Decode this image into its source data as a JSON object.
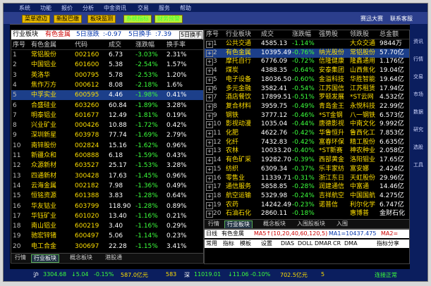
{
  "menubar": {
    "items": [
      "系统",
      "功能",
      "报价",
      "分析",
      "中金资讯",
      "交易",
      "服务",
      "帮助"
    ]
  },
  "toolbar": {
    "btns": [
      "菜单遮边",
      "新股巴缴",
      "板块监测",
      "系统指标",
      "财务预警"
    ],
    "right1": "赛迅大赛",
    "right2": "联系客服"
  },
  "left": {
    "title": {
      "a": "行业板块",
      "b": "有色金属",
      "c": "5日涨跌",
      "d": ":-0.97",
      "e": "5日换手",
      "f": ":7.39",
      "g": "5日换手"
    },
    "headers": [
      "序号",
      "有色金属",
      "代码",
      "成交",
      "涨跌幅",
      "换手率"
    ],
    "rows": [
      [
        "1",
        "常铝股份",
        "002160",
        "6.73",
        "-3.03%",
        "2.31%"
      ],
      [
        "2",
        "中国铝业",
        "601600",
        "5.38",
        "-2.54%",
        "1.57%"
      ],
      [
        "3",
        "英洛华",
        "000795",
        "5.78",
        "-2.53%",
        "1.20%"
      ],
      [
        "4",
        "焦作万方",
        "000612",
        "8.08",
        "-2.18%",
        "1.6%"
      ],
      [
        "5",
        "中孚实业",
        "600595",
        "4.46",
        "-1.98%",
        "0.41%"
      ],
      [
        "6",
        "合盛硅业",
        "603260",
        "60.84",
        "-1.89%",
        "3.28%"
      ],
      [
        "7",
        "明泰铝业",
        "601677",
        "12.49",
        "-1.81%",
        "0.19%"
      ],
      [
        "8",
        "兴业矿业",
        "000426",
        "10.88",
        "-1.72%",
        "0.42%"
      ],
      [
        "9",
        "深圳新星",
        "603978",
        "77.74",
        "-1.69%",
        "2.79%"
      ],
      [
        "10",
        "南锌股份",
        "002824",
        "15.16",
        "-1.62%",
        "0.96%"
      ],
      [
        "11",
        "新疆众和",
        "600888",
        "6.18",
        "-1.59%",
        "0.43%"
      ],
      [
        "12",
        "众源新材",
        "603527",
        "25.17",
        "-1.53%",
        "3.28%"
      ],
      [
        "13",
        "四通新材",
        "300428",
        "17.63",
        "-1.45%",
        "0.96%"
      ],
      [
        "14",
        "云海金属",
        "002182",
        "7.98",
        "-1.36%",
        "0.49%"
      ],
      [
        "15",
        "恒铭资源",
        "601388",
        "3.83",
        "-1.28%",
        "0.64%"
      ],
      [
        "16",
        "华友钴业",
        "603799",
        "118.90",
        "-1.28%",
        "0.89%"
      ],
      [
        "17",
        "华钰矿业",
        "601020",
        "13.40",
        "-1.16%",
        "0.21%"
      ],
      [
        "18",
        "南山铝业",
        "600219",
        "3.40",
        "-1.16%",
        "0.29%"
      ],
      [
        "19",
        "驰宏锌锗",
        "600497",
        "5.06",
        "-1.14%",
        "0.23%"
      ],
      [
        "20",
        "电工合金",
        "300697",
        "22.28",
        "-1.15%",
        "3.41%"
      ]
    ],
    "tabs": [
      "行情",
      "行业板块",
      "概念板块",
      "港股通"
    ],
    "active_tab": "行业板块"
  },
  "right": {
    "headers": [
      "序号",
      "行业板块",
      "成交",
      "涨跌幅",
      "强势股",
      "领跌股",
      "总金额"
    ],
    "rows": [
      [
        "1",
        "公共交通",
        "4585.13",
        "-1.14%",
        "",
        "大众交通",
        "9844万"
      ],
      [
        "2",
        "有色金属",
        "10395.49",
        "-0.76%",
        "纳光股份",
        "常铝股份",
        "57.70亿"
      ],
      [
        "3",
        "摩托自行",
        "6776.09",
        "-0.72%",
        "信隆健康",
        "隆鑫通用",
        "1.176亿"
      ],
      [
        "4",
        "煤炭",
        "4388.35",
        "-0.64%",
        "安泰集团",
        "山西焦化",
        "19.04亿"
      ],
      [
        "5",
        "电子设备",
        "18036.50",
        "-0.60%",
        "金溢科技",
        "华胜智能",
        "19.64亿"
      ],
      [
        "6",
        "多元金融",
        "3582.41",
        "-0.54%",
        "江苏国信",
        "江苏租赁",
        "17.94亿"
      ],
      [
        "7",
        "酒店餐饮",
        "17899.51",
        "-0.51%",
        "罗顿发展",
        "*ST云网",
        "4.532亿"
      ],
      [
        "8",
        "复合材料",
        "3959.75",
        "-0.49%",
        "青岛金王",
        "永悦科技",
        "22.99亿"
      ],
      [
        "9",
        "钢铁",
        "3777.12",
        "-0.46%",
        "*ST金钢",
        "八一钢铁",
        "6.573亿"
      ],
      [
        "10",
        "影视动漫",
        "1035.04",
        "-0.44%",
        "唐德影视",
        "中南文化",
        "9.992亿"
      ],
      [
        "11",
        "化肥",
        "4622.76",
        "-0.42%",
        "华鲁恒升",
        "鲁西化工",
        "7.853亿"
      ],
      [
        "12",
        "化纤",
        "7432.83",
        "-0.42%",
        "富春环保",
        "精工股份",
        "6.635亿"
      ],
      [
        "13",
        "农林",
        "10033.20",
        "-0.40%",
        "*ST新赛",
        "神农种业",
        "2.058亿"
      ],
      [
        "14",
        "有色矿采",
        "19282.70",
        "-0.39%",
        "西部黄金",
        "洛阳钼业",
        "17.65亿"
      ],
      [
        "15",
        "纺织",
        "6309.34",
        "-0.37%",
        "乐丰家纺",
        "富安娜",
        "2.424亿"
      ],
      [
        "16",
        "零售业",
        "11339.71",
        "-0.31%",
        "浙江东日",
        "天虹股份",
        "29.96亿"
      ],
      [
        "17",
        "通信服务",
        "5858.85",
        "-0.28%",
        "润建通信",
        "中富通",
        "14.46亿"
      ],
      [
        "18",
        "航空运输",
        "5329.98",
        "-0.24%",
        "吉祥航空",
        "中国国航",
        "4.275亿"
      ],
      [
        "19",
        "农药",
        "14242.49",
        "-0.23%",
        "诺普信",
        "利尔化学",
        "6.747亿"
      ],
      [
        "20",
        "石油石化",
        "2860.11",
        "-0.18%",
        "",
        "惠博普",
        "金财石化"
      ]
    ],
    "tabs": [
      "行情",
      "行业板块",
      "概念板块",
      "入围股板块",
      "入围"
    ],
    "active_tab": "行业板块"
  },
  "kline": {
    "label1": "日线",
    "label2": "有色金属",
    "ma": "MA5↑(10,20,40,60,120,5)",
    "ma1": "MA1=10437.475",
    "ma2": "MA2=",
    "btns": [
      "常用",
      "指标",
      "模板",
      "设置"
    ],
    "indicators": [
      "DIAS",
      "DOLL",
      "DMAR",
      "CR",
      "DMA"
    ],
    "right_btn": "指标分享"
  },
  "status": {
    "a": "沪",
    "b": "3304.68",
    "c": "↓5.04",
    "d": "-0.15%",
    "e": "587.0亿元",
    "f": "583",
    "g": "深",
    "h": "11019.01",
    "i": "↓11.06",
    "j": "-0.10%",
    "k": "702.5亿元",
    "l": "5",
    "m": "连接正常"
  },
  "colors": {
    "up": "#ff4040",
    "down": "#3cff3c",
    "name": "#ffdf00",
    "header_bg": "#0b1e5e"
  }
}
